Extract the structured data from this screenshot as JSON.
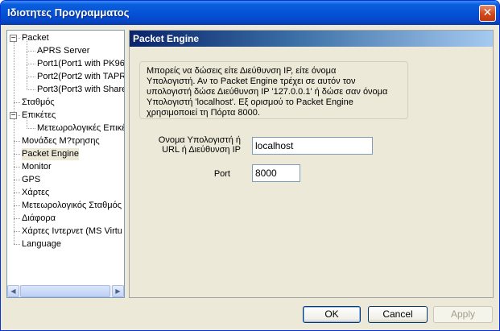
{
  "window": {
    "title": "Ιδιοτητες Προγραμματος",
    "close_glyph": "✕"
  },
  "tree": {
    "items": [
      {
        "label": "Packet",
        "level": 0,
        "expander": "−"
      },
      {
        "label": "APRS Server",
        "level": 1
      },
      {
        "label": "Port1(Port1 with PK96",
        "level": 1
      },
      {
        "label": "Port2(Port2 with TAPR",
        "level": 1
      },
      {
        "label": "Port3(Port3 with Share",
        "level": 1
      },
      {
        "label": "Σταθμός",
        "level": 0
      },
      {
        "label": "Επικέτες",
        "level": 0,
        "expander": "−"
      },
      {
        "label": "Μετεωρολογικές Επικέ",
        "level": 1
      },
      {
        "label": "Μονάδες Μ?τρησης",
        "level": 0
      },
      {
        "label": "Packet Engine",
        "level": 0,
        "selected": true
      },
      {
        "label": "Monitor",
        "level": 0
      },
      {
        "label": "GPS",
        "level": 0
      },
      {
        "label": "Χάρτες",
        "level": 0
      },
      {
        "label": "Μετεωρολογικός Σταθμός",
        "level": 0
      },
      {
        "label": "Διάφορα",
        "level": 0
      },
      {
        "label": "Χάρτες Ιντερνετ (MS Virtu",
        "level": 0
      },
      {
        "label": "Language",
        "level": 0
      }
    ],
    "scroll_left": "◀",
    "scroll_right": "▶"
  },
  "content": {
    "section_title": "Packet Engine",
    "info_lines": [
      "Μπορείς να δώσεις είτε Διεύθυνση IP, είτε όνομα",
      "Υπολογιστή. Αν το Packet Engine τρέχει σε αυτόν τον",
      "υπολογιστή δώσε Διεύθυνση IP '127.0.0.1' ή δώσε σαν όνομα",
      "Υπολογιστή 'localhost'. Εξ ορισμού το Packet Engine",
      "χρησιμοποιεί τη Πόρτα 8000."
    ],
    "host_label_line1": "Ονομα Υπολογιστή ή",
    "host_label_line2": "URL ή Διεύθυνση IP",
    "host_value": "localhost",
    "port_label": "Port",
    "port_value": "8000"
  },
  "buttons": {
    "ok": "OK",
    "cancel": "Cancel",
    "apply": "Apply"
  }
}
